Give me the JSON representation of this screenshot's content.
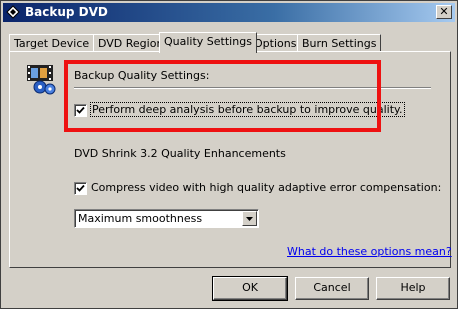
{
  "window": {
    "title": "Backup DVD",
    "close_glyph": "✕"
  },
  "tabs": [
    {
      "label": "Target Device",
      "active": false
    },
    {
      "label": "DVD Region",
      "active": false
    },
    {
      "label": "Quality Settings",
      "active": true
    },
    {
      "label": "Options",
      "active": false
    },
    {
      "label": "Burn Settings",
      "active": false
    }
  ],
  "quality": {
    "section_title": "Backup Quality Settings:",
    "deep_analysis_label": "Perform deep analysis before backup to improve quality.",
    "deep_analysis_checked": true
  },
  "enhancements": {
    "section_title": "DVD Shrink 3.2 Quality Enhancements",
    "compress_label": "Compress video with high quality adaptive error compensation:",
    "compress_checked": true,
    "smoothing_selected": "Maximum smoothness"
  },
  "help_link": "What do these options mean?",
  "buttons": {
    "ok": "OK",
    "cancel": "Cancel",
    "help": "Help"
  },
  "colors": {
    "highlight": "#ee1111",
    "link": "#0000ee",
    "titlebar": "#0a246a"
  },
  "icons": {
    "app": "dvd-shrink-icon",
    "settings": "film-gears-icon"
  }
}
